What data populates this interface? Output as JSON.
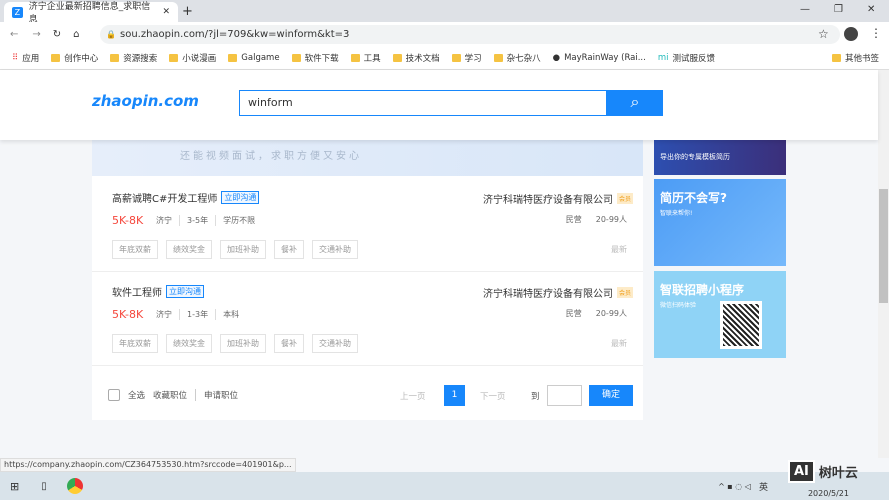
{
  "browser": {
    "tab_title": "济宁企业最新招聘信息_求职信息",
    "new_tab": "+",
    "url": "sou.zhaopin.com/?jl=709&kw=winform&kt=3",
    "bookmarks": [
      "应用",
      "创作中心",
      "资源搜索",
      "小说漫画",
      "Galgame",
      "软件下载",
      "工具",
      "技术文档",
      "学习",
      "杂七杂八",
      "MayRainWay (Rai...",
      "测试服反馈"
    ],
    "other_bookmarks": "其他书签"
  },
  "header": {
    "logo": "智联招聘 zhaopin.com",
    "search_value": "winform"
  },
  "banner": {
    "text": "还能视频面试，求职方便又安心"
  },
  "jobs": [
    {
      "title": "高薪诚聘C#开发工程师",
      "chat": "立即沟通",
      "salary": "5K-8K",
      "meta": [
        "济宁",
        "3-5年",
        "学历不限"
      ],
      "tags": [
        "年底双薪",
        "绩效奖金",
        "加班补助",
        "餐补",
        "交通补助"
      ],
      "company": "济宁科瑞特医疗设备有限公司",
      "vip": "会员",
      "company_meta": [
        "民营",
        "20-99人"
      ],
      "newest": "最新"
    },
    {
      "title": "软件工程师",
      "chat": "立即沟通",
      "salary": "5K-8K",
      "meta": [
        "济宁",
        "1-3年",
        "本科"
      ],
      "tags": [
        "年底双薪",
        "绩效奖金",
        "加班补助",
        "餐补",
        "交通补助"
      ],
      "company": "济宁科瑞特医疗设备有限公司",
      "vip": "会员",
      "company_meta": [
        "民营",
        "20-99人"
      ],
      "newest": "最新"
    }
  ],
  "footer": {
    "select_all": "全选",
    "favorite": "收藏职位",
    "apply": "申请职位",
    "prev": "上一页",
    "page": "1",
    "next": "下一页",
    "goto": "到",
    "confirm": "确定"
  },
  "ads": [
    {
      "subtitle": "导出你的专属模板简历"
    },
    {
      "title": "简历不会写?",
      "subtitle": "智联来帮你!"
    },
    {
      "title": "智联招聘小程序",
      "subtitle": "微信扫码体验"
    }
  ],
  "status_url": "https://company.zhaopin.com/CZ364753530.htm?srccode=401901&p...",
  "taskbar": {
    "ime": "英",
    "date": "2020/5/21"
  },
  "watermark": "AI 树叶云"
}
